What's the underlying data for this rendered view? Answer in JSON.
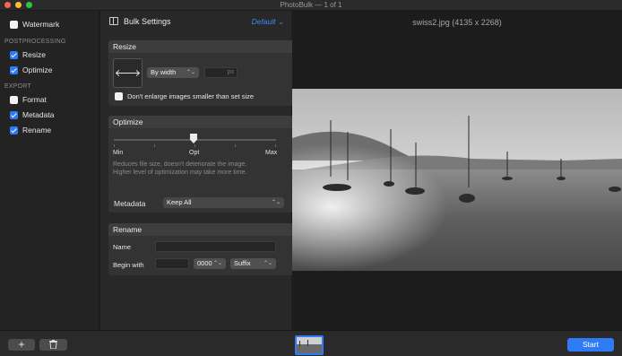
{
  "window": {
    "title": "PhotoBulk — 1 of 1"
  },
  "sidebar": {
    "watermark": {
      "label": "Watermark",
      "checked": false
    },
    "postprocessing_label": "POSTPROCESSING",
    "resize": {
      "label": "Resize",
      "checked": true
    },
    "optimize": {
      "label": "Optimize",
      "checked": true
    },
    "export_label": "EXPORT",
    "format": {
      "label": "Format",
      "checked": false
    },
    "metadata": {
      "label": "Metadata",
      "checked": true
    },
    "rename": {
      "label": "Rename",
      "checked": true
    }
  },
  "settings": {
    "title": "Bulk Settings",
    "preset": "Default",
    "resize": {
      "header": "Resize",
      "mode": "By width",
      "value": "",
      "unit": "px",
      "dont_enlarge": {
        "label": "Don't enlarge images smaller than set size",
        "checked": false
      }
    },
    "optimize": {
      "header": "Optimize",
      "min_label": "Min",
      "opt_label": "Opt",
      "max_label": "Max",
      "level_fraction": 0.5,
      "note_line1": "Reduces file size, doesn't deteriorate the image.",
      "note_line2": "Higher level of optimization may take more time."
    },
    "metadata": {
      "label": "Metadata",
      "value": "Keep All"
    },
    "rename": {
      "header": "Rename",
      "name_label": "Name",
      "name_value": "",
      "begin_label": "Begin with",
      "begin_value": "",
      "counter": "0000",
      "position": "Suffix"
    }
  },
  "preview": {
    "file_title": "swiss2.jpg (4135 x 2268)"
  },
  "bottom": {
    "add_label": "+",
    "start_label": "Start"
  },
  "colors": {
    "accent": "#2f7bf5",
    "sidebar_bg": "#232323",
    "panel_bg": "#282828",
    "preview_bg": "#1c1c1c"
  }
}
